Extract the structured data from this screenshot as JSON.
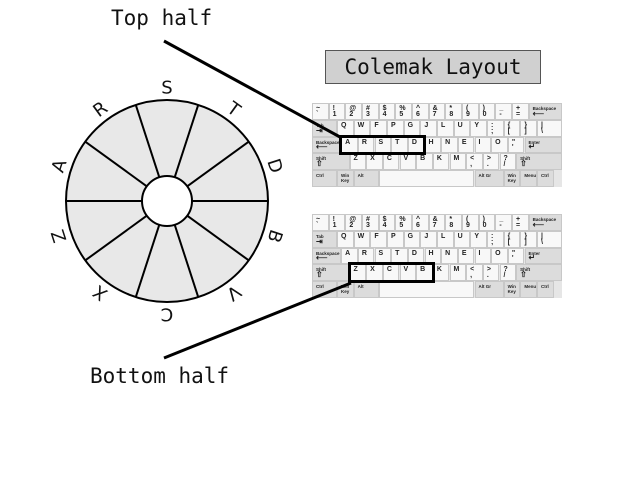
{
  "labels": {
    "top": "Top half",
    "bottom": "Bottom half",
    "title": "Colemak Layout"
  },
  "wheel": {
    "letters": [
      "S",
      "T",
      "D",
      "B",
      "V",
      "C",
      "X",
      "Z",
      "A",
      "R"
    ],
    "segments": 10,
    "fill": "#e8e8e8"
  },
  "keyboards": [
    {
      "name": "top-half-keyboard",
      "highlight": [
        "A",
        "R",
        "S",
        "T",
        "D"
      ]
    },
    {
      "name": "bottom-half-keyboard",
      "highlight": [
        "Z",
        "X",
        "C",
        "V",
        "B"
      ]
    }
  ],
  "rows": [
    [
      {
        "p": "~",
        "s": "`"
      },
      {
        "p": "!",
        "s": "1"
      },
      {
        "p": "@",
        "s": "2"
      },
      {
        "p": "#",
        "s": "3"
      },
      {
        "p": "$",
        "s": "4"
      },
      {
        "p": "%",
        "s": "5"
      },
      {
        "p": "^",
        "s": "6"
      },
      {
        "p": "&",
        "s": "7"
      },
      {
        "p": "*",
        "s": "8"
      },
      {
        "p": "(",
        "s": "9"
      },
      {
        "p": ")",
        "s": "0"
      },
      {
        "p": "_",
        "s": "-"
      },
      {
        "p": "+",
        "s": "="
      },
      {
        "m": "Backspace",
        "ico": "⟵",
        "w": 2,
        "mod": true
      }
    ],
    [
      {
        "m": "Tab",
        "ico": "⇥",
        "w": 1.5,
        "mod": true
      },
      {
        "p": "Q"
      },
      {
        "p": "W"
      },
      {
        "p": "F"
      },
      {
        "p": "P"
      },
      {
        "p": "G"
      },
      {
        "p": "J"
      },
      {
        "p": "L"
      },
      {
        "p": "U"
      },
      {
        "p": "Y"
      },
      {
        "p": ":",
        "s": ";"
      },
      {
        "p": "{",
        "s": "["
      },
      {
        "p": "}",
        "s": "]"
      },
      {
        "p": "|",
        "s": "\\",
        "w": 1.5
      }
    ],
    [
      {
        "m": "Backspace",
        "ico": "⟵",
        "w": 1.75,
        "mod": true
      },
      {
        "p": "A"
      },
      {
        "p": "R"
      },
      {
        "p": "S"
      },
      {
        "p": "T"
      },
      {
        "p": "D"
      },
      {
        "p": "H"
      },
      {
        "p": "N"
      },
      {
        "p": "E"
      },
      {
        "p": "I"
      },
      {
        "p": "O"
      },
      {
        "p": "\"",
        "s": "'"
      },
      {
        "m": "Enter",
        "ico": "↵",
        "w": 2.25,
        "mod": true
      }
    ],
    [
      {
        "m": "Shift",
        "ico": "⇧",
        "w": 2.25,
        "mod": true
      },
      {
        "p": "Z"
      },
      {
        "p": "X"
      },
      {
        "p": "C"
      },
      {
        "p": "V"
      },
      {
        "p": "B"
      },
      {
        "p": "K"
      },
      {
        "p": "M"
      },
      {
        "p": "<",
        "s": ","
      },
      {
        "p": ">",
        "s": "."
      },
      {
        "p": "?",
        "s": "/"
      },
      {
        "m": "Shift",
        "ico": "⇧",
        "w": 2.75,
        "mod": true
      }
    ],
    [
      {
        "m": "Ctrl",
        "w": 1.5,
        "mod": true
      },
      {
        "m": "Win Key",
        "w": 1.0,
        "mod": true
      },
      {
        "m": "Alt",
        "w": 1.5,
        "mod": true
      },
      {
        "m": "",
        "w": 5.75,
        "space": true
      },
      {
        "m": "Alt Gr",
        "w": 1.75,
        "mod": true
      },
      {
        "m": "Win Key",
        "w": 1.0,
        "mod": true
      },
      {
        "m": "Menu",
        "w": 1.0,
        "mod": true
      },
      {
        "m": "Ctrl",
        "w": 1.0,
        "mod": true
      }
    ]
  ]
}
